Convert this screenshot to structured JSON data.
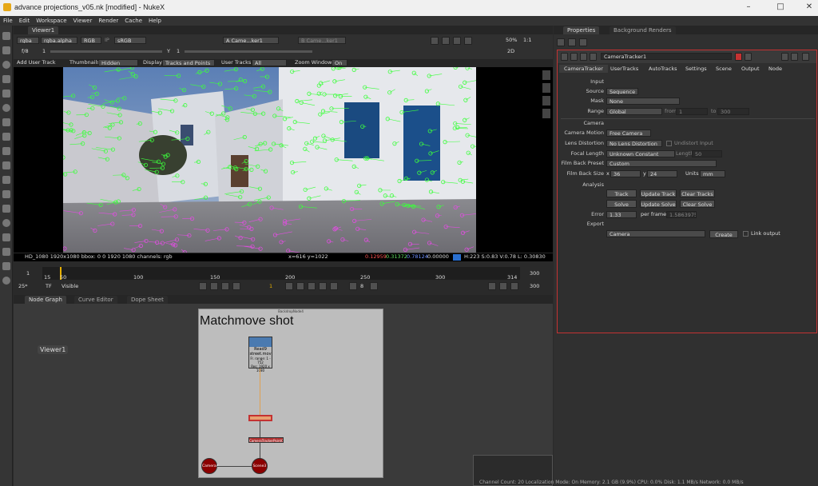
{
  "window": {
    "title": "advance projections_v05.nk [modified] - NukeX"
  },
  "menu": [
    "File",
    "Edit",
    "Workspace",
    "Viewer",
    "Render",
    "Cache",
    "Help"
  ],
  "viewer": {
    "tab_label": "Viewer1",
    "channels": "rgba",
    "alpha": "rgba.alpha",
    "colorspace_mode": "RGB",
    "ip": "IP",
    "lut": "sRGB",
    "input_a": "A  Came...ker1",
    "input_b": "B  Came...ker1",
    "zoom": "50%",
    "ratio": "1:1",
    "fstop": "f/8",
    "gain": "1",
    "gamma_label": "Y",
    "gamma": "1",
    "mode_2d": "2D",
    "overlay": {
      "add_user_track": "Add User Track",
      "thumbnails_label": "Thumbnails",
      "thumbnails_value": "Hidden",
      "display_label": "Display",
      "display_value": "Tracks and Points",
      "user_tracks_label": "User Tracks",
      "user_tracks_value": "All",
      "zoom_window_label": "Zoom Window",
      "zoom_window_value": "On"
    },
    "status": {
      "format": "HD_1080 1920x1080  bbox: 0 0 1920 1080 channels: rgb",
      "coords": "x=616 y=1022",
      "r": "0.12959",
      "g": "0.31372",
      "b": "0.78124",
      "a": "0.00000",
      "hsv": "H:223 S:0.83 V:0.78  L: 0.30830"
    }
  },
  "timeline": {
    "start": "1",
    "end": "300",
    "ticks": [
      "15",
      "50",
      "100",
      "150",
      "200",
      "250",
      "300",
      "314"
    ],
    "current_frame": "1",
    "fps": "25*",
    "tf": "TF",
    "visible": "Visible",
    "step": "8",
    "end_frame": "300"
  },
  "node_graph": {
    "tabs": [
      "Node Graph",
      "Curve Editor",
      "Dope Sheet"
    ],
    "viewer_node": "Viewer1",
    "backdrop_label": "BackdropNode4",
    "backdrop_title": "Matchmove shot",
    "read_node_lines": [
      "Read9",
      "street.mov",
      "Fr. range: 1 - 752",
      "Res: 1920 x 1080"
    ],
    "tracker_node": "CameraTracker1",
    "tracker_points": "CameraTrackerPointCloud1",
    "camera_node": "Camera4",
    "scene_node": "Scene3"
  },
  "properties": {
    "tabs": [
      "Properties",
      "Background Renders"
    ],
    "node_name": "CameraTracker1",
    "sub_tabs": [
      "CameraTracker",
      "UserTracks",
      "AutoTracks",
      "Settings",
      "Scene",
      "Output",
      "Node"
    ],
    "input_header": "Input",
    "source_label": "Source",
    "source_value": "Sequence",
    "mask_label": "Mask",
    "mask_value": "None",
    "range_label": "Range",
    "range_value": "Global",
    "from_label": "from",
    "from_value": "1",
    "to_label": "to",
    "to_value": "300",
    "camera_header": "Camera",
    "motion_label": "Camera Motion",
    "motion_value": "Free Camera",
    "lens_label": "Lens Distortion",
    "lens_value": "No Lens Distortion",
    "undistort": "Undistort Input",
    "focal_label": "Focal Length",
    "focal_value": "Unknown Constant",
    "length_label": "Length",
    "length_value": "50",
    "filmback_label": "Film Back Preset",
    "filmback_value": "Custom",
    "filmsize_label": "Film Back Size",
    "x_label": "x",
    "x_value": "36",
    "y_label": "y",
    "y_value": "24",
    "units_label": "Units",
    "units_value": "mm",
    "analysis_header": "Analysis",
    "track_btn": "Track",
    "update_track_btn": "Update Track",
    "clear_tracks_btn": "Clear Tracks",
    "solve_btn": "Solve",
    "update_solve_btn": "Update Solve",
    "clear_solve_btn": "Clear Solve",
    "error_label": "Error",
    "error_value": "1.33",
    "per_frame_label": "per frame",
    "per_frame_value": "1.58639752",
    "export_header": "Export",
    "export_value": "Camera",
    "create_btn": "Create",
    "link_output": "Link output"
  },
  "status_bar": "Channel Count: 20  Localization Mode: On  Memory: 2.1 GB (9.9%)  CPU: 0.0%  Disk: 1.1 MB/s  Network: 0.0 MB/s",
  "colors": {
    "accent_red": "#c43232",
    "track_green": "#3cff3c",
    "track_magenta": "#e04fe0",
    "node_dark_red": "#8b0000"
  }
}
